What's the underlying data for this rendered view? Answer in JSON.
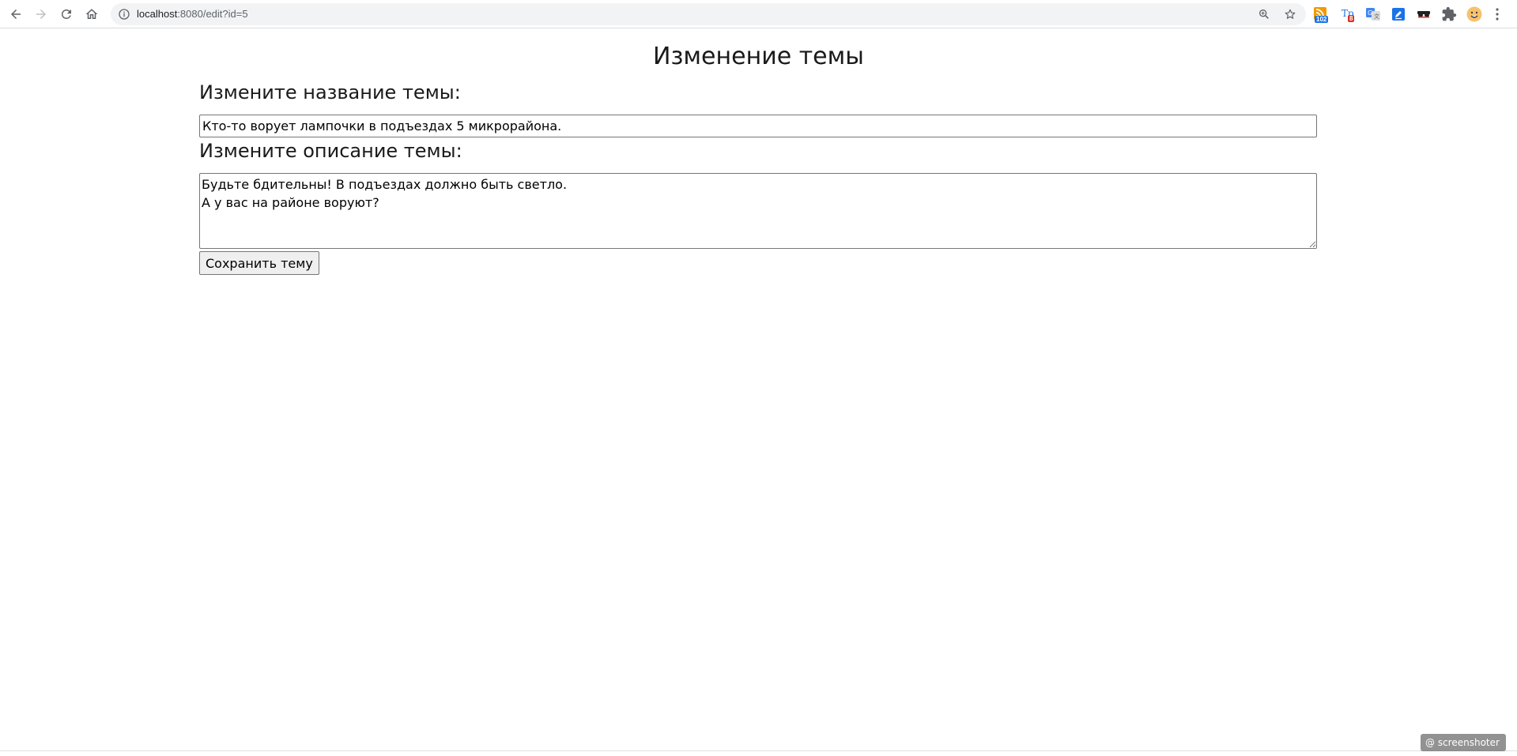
{
  "browser": {
    "url_host": "localhost",
    "url_path": ":8080/edit?id=5",
    "extensions": [
      {
        "icon": "rss-feed-icon",
        "badge": "102",
        "badge_color": "#1a73e8"
      },
      {
        "icon": "translator-icon",
        "badge": "8",
        "badge_color": "#d93025"
      },
      {
        "icon": "google-translate-icon"
      },
      {
        "icon": "edit-extension-icon"
      },
      {
        "icon": "incognito-glasses-icon"
      },
      {
        "icon": "puzzle-extensions-icon"
      },
      {
        "icon": "profile-avatar-icon"
      },
      {
        "icon": "kebab-menu-icon"
      }
    ]
  },
  "page": {
    "title": "Изменение темы",
    "name_label": "Измените название темы:",
    "name_value": "Кто-то ворует лампочки в подъездах 5 микрорайона.",
    "description_label": "Измените описание темы:",
    "description_value": "Будьте бдительны! В подъездах должно быть светло.\nА у вас на районе воруют?",
    "save_button": "Сохранить тему"
  },
  "watermark": "@ screenshoter"
}
